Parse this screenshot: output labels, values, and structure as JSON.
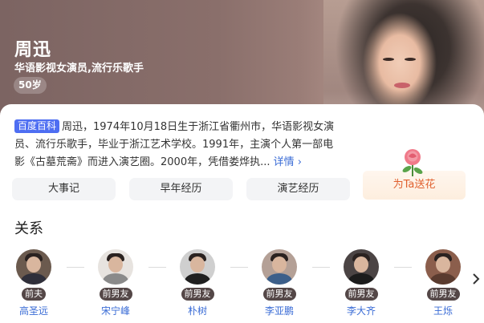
{
  "profile": {
    "name": "周迅",
    "subtitle": "华语影视女演员,流行乐歌手",
    "age": "50岁",
    "more_icon": "more-dots-icon"
  },
  "summary": {
    "badge": "百度百科",
    "text": "周迅，1974年10月18日生于浙江省衢州市，华语影视女演员、流行乐歌手，毕业于浙江艺术学校。1991年，主演个人第一部电影《古墓荒斋》而进入演艺圈。2000年，凭借娄烨执...",
    "detail_link": "详情 ›"
  },
  "gift": {
    "label": "为Ta送花",
    "icon": "rose-icon"
  },
  "tabs": [
    {
      "label": "大事记"
    },
    {
      "label": "早年经历"
    },
    {
      "label": "演艺经历"
    }
  ],
  "relations": {
    "title": "关系",
    "people": [
      {
        "tag": "前夫",
        "name": "高圣远"
      },
      {
        "tag": "前男友",
        "name": "宋宁峰"
      },
      {
        "tag": "前男友",
        "name": "朴树"
      },
      {
        "tag": "前男友",
        "name": "李亚鹏"
      },
      {
        "tag": "前男友",
        "name": "李大齐"
      },
      {
        "tag": "前男友",
        "name": "王烁"
      }
    ],
    "next_icon": "chevron-right-icon"
  },
  "colors": {
    "accent": "#4e6ef2",
    "link": "#3a6cd6",
    "tag_bg": "#544747",
    "gift_text": "#e0602e"
  }
}
